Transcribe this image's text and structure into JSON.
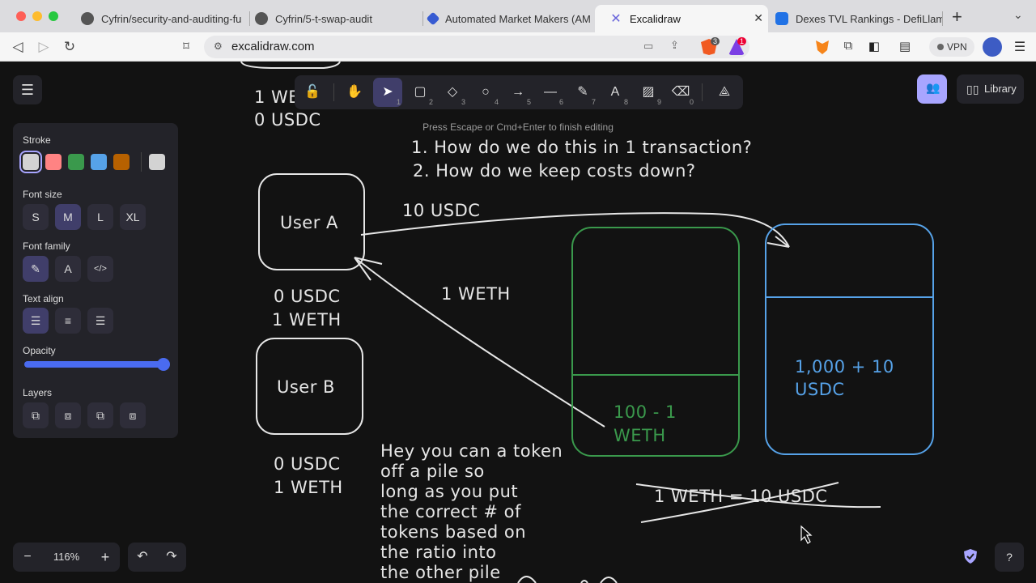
{
  "browser": {
    "tabs": [
      {
        "title": "Cyfrin/security-and-auditing-fu",
        "icon": "github-icon"
      },
      {
        "title": "Cyfrin/5-t-swap-audit",
        "icon": "github-icon"
      },
      {
        "title": "Automated Market Makers (AM",
        "icon": "chainlink-icon"
      },
      {
        "title": "Excalidraw",
        "icon": "excalidraw-icon",
        "active": true
      },
      {
        "title": "Dexes TVL Rankings - DefiLlam",
        "icon": "defillama-icon"
      }
    ],
    "new_tab": "+",
    "url": "excalidraw.com",
    "badges": {
      "brave_shield": "3",
      "brave_rewards": "1"
    },
    "vpn_label": "VPN"
  },
  "excalidraw": {
    "hint": "Press Escape or Cmd+Enter to finish editing",
    "library_label": "Library",
    "tools": [
      {
        "name": "lock",
        "glyph": "🔓",
        "key": ""
      },
      {
        "name": "hand",
        "glyph": "✋",
        "key": ""
      },
      {
        "name": "selection",
        "glyph": "➤",
        "key": "1",
        "selected": true
      },
      {
        "name": "rectangle",
        "glyph": "▢",
        "key": "2"
      },
      {
        "name": "diamond",
        "glyph": "◇",
        "key": "3"
      },
      {
        "name": "ellipse",
        "glyph": "○",
        "key": "4"
      },
      {
        "name": "arrow",
        "glyph": "→",
        "key": "5"
      },
      {
        "name": "line",
        "glyph": "—",
        "key": "6"
      },
      {
        "name": "draw",
        "glyph": "✎",
        "key": "7"
      },
      {
        "name": "text",
        "glyph": "A",
        "key": "8"
      },
      {
        "name": "image",
        "glyph": "▨",
        "key": "9"
      },
      {
        "name": "eraser",
        "glyph": "⌫",
        "key": "0"
      },
      {
        "name": "more-shapes",
        "glyph": "⟁",
        "key": ""
      }
    ],
    "properties": {
      "stroke_label": "Stroke",
      "stroke_colors": [
        "#d3d3d3",
        "#ff8383",
        "#3a994c",
        "#56a2e8",
        "#b76100"
      ],
      "current_stroke": "#d3d3d3",
      "font_size_label": "Font size",
      "font_sizes": [
        "S",
        "M",
        "L",
        "XL"
      ],
      "font_size_selected": "M",
      "font_family_label": "Font family",
      "text_align_label": "Text align",
      "opacity_label": "Opacity",
      "opacity_value": 100,
      "layers_label": "Layers"
    },
    "zoom": {
      "minus": "−",
      "value": "116%",
      "plus": "+"
    }
  },
  "drawing": {
    "top_left_text": [
      "1 WETH",
      "0 USDC"
    ],
    "questions": [
      "1. How do we do this in 1 transaction?",
      "2. How do we keep costs down?"
    ],
    "user_a": "User A",
    "user_b": "User B",
    "arrow_usdc_label": "10 USDC",
    "arrow_weth_label": "1 WETH",
    "user_a_balance": [
      "0 USDC",
      "1 WETH"
    ],
    "user_b_balance": [
      "0 USDC",
      "1 WETH"
    ],
    "weth_pool": [
      "100 - 1",
      "WETH"
    ],
    "usdc_pool": [
      "1,000 + 10",
      "USDC"
    ],
    "ratio_struck": "1 WETH = 10 USDC",
    "note": [
      "Hey you can a token",
      "off a pile so",
      "long as you put",
      "the correct # of",
      "tokens based on",
      "the ratio into",
      "the other pile"
    ]
  }
}
